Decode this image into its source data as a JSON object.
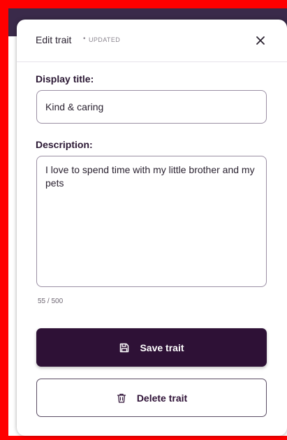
{
  "modal": {
    "title": "Edit trait",
    "separator": "•",
    "status": "UPDATED"
  },
  "form": {
    "title_label": "Display title:",
    "title_value": "Kind & caring",
    "description_label": "Description:",
    "description_value": "I love to spend time with my little brother and my pets",
    "char_count": "55 / 500"
  },
  "actions": {
    "save_label": "Save trait",
    "delete_label": "Delete trait"
  },
  "icons": {
    "close": "close-icon",
    "save": "save-icon",
    "delete": "trash-icon"
  },
  "colors": {
    "primary": "#2e1136",
    "frame": "#ff0000",
    "backdrop": "#3a2a4a"
  }
}
